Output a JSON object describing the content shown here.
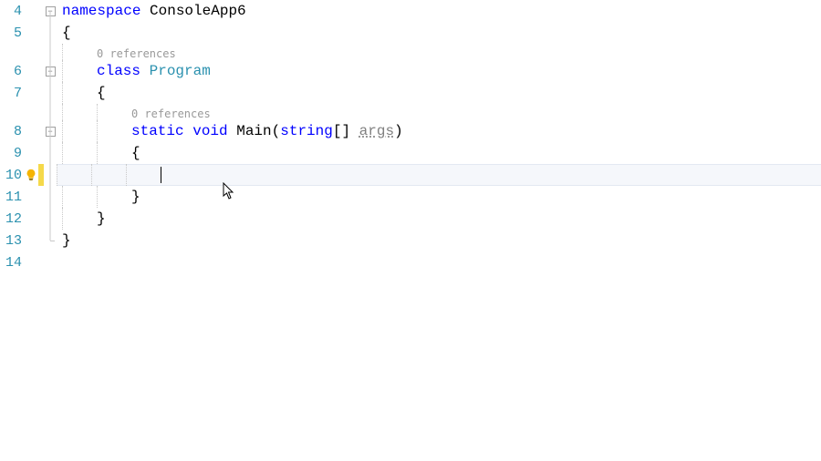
{
  "lineNumbers": [
    "4",
    "5",
    "6",
    "7",
    "8",
    "9",
    "10",
    "11",
    "12",
    "13",
    "14"
  ],
  "codelens": {
    "classRefs": "0 references",
    "mainRefs": "0 references"
  },
  "code": {
    "ns_kw": "namespace",
    "ns_name": " ConsoleApp6",
    "brace_open": "{",
    "brace_close": "}",
    "class_kw": "class",
    "class_name": " Program",
    "static_kw": "static",
    "sp": " ",
    "void_kw": "void",
    "main_name": " Main(",
    "string_kw": "string",
    "arr": "[] ",
    "args": "args",
    "close_paren": ")"
  },
  "icons": {
    "bulb": "lightbulb-icon",
    "foldMinus": "−"
  },
  "colors": {
    "keyword": "#0000ff",
    "type": "#2b91af",
    "lineNumber": "#2b91af",
    "codelens": "#999999"
  }
}
